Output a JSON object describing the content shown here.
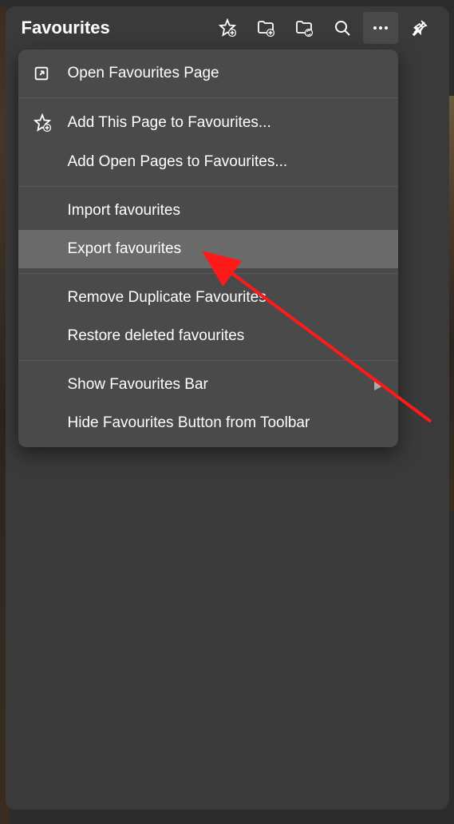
{
  "header": {
    "title": "Favourites"
  },
  "menu": {
    "items": [
      {
        "label": "Open Favourites Page",
        "icon": "open-page",
        "hasSubmenu": false
      },
      {
        "separator": true
      },
      {
        "label": "Add This Page to Favourites...",
        "icon": "star-add",
        "hasSubmenu": false
      },
      {
        "label": "Add Open Pages to Favourites...",
        "icon": "",
        "hasSubmenu": false
      },
      {
        "separator": true
      },
      {
        "label": "Import favourites",
        "icon": "",
        "hasSubmenu": false
      },
      {
        "label": "Export favourites",
        "icon": "",
        "hasSubmenu": false,
        "highlighted": true
      },
      {
        "separator": true
      },
      {
        "label": "Remove Duplicate Favourites",
        "icon": "",
        "hasSubmenu": false
      },
      {
        "label": "Restore deleted favourites",
        "icon": "",
        "hasSubmenu": false
      },
      {
        "separator": true
      },
      {
        "label": "Show Favourites Bar",
        "icon": "",
        "hasSubmenu": true
      },
      {
        "label": "Hide Favourites Button from Toolbar",
        "icon": "",
        "hasSubmenu": false
      }
    ]
  }
}
